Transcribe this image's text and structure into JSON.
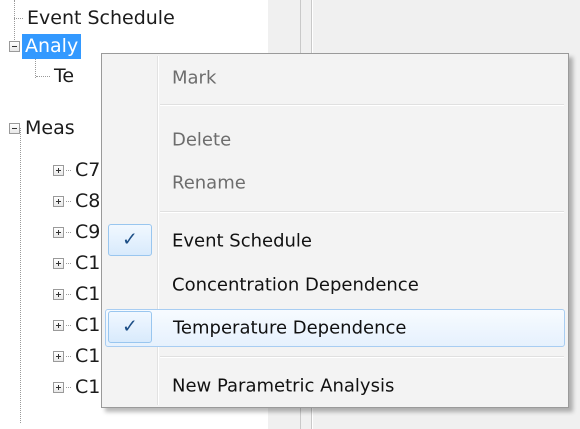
{
  "tree": {
    "nodes": [
      {
        "label": "Event Schedule",
        "expander": "none"
      },
      {
        "label": "Analy",
        "expander": "minus",
        "selected": true
      },
      {
        "label": "Te",
        "expander": "none"
      },
      {
        "label": "Meas",
        "expander": "minus"
      },
      {
        "label": "C7",
        "expander": "plus"
      },
      {
        "label": "C8",
        "expander": "plus"
      },
      {
        "label": "C9",
        "expander": "plus"
      },
      {
        "label": "C1",
        "expander": "plus"
      },
      {
        "label": "C1",
        "expander": "plus"
      },
      {
        "label": "C1",
        "expander": "plus"
      },
      {
        "label": "C1",
        "expander": "plus"
      },
      {
        "label": "C1",
        "expander": "plus"
      }
    ]
  },
  "context_menu": {
    "items": [
      {
        "label": "Mark",
        "enabled": false,
        "checked": false
      },
      {
        "label": "Delete",
        "enabled": false,
        "checked": false
      },
      {
        "label": "Rename",
        "enabled": false,
        "checked": false
      },
      {
        "label": "Event Schedule",
        "enabled": true,
        "checked": true
      },
      {
        "label": "Concentration Dependence",
        "enabled": true,
        "checked": false
      },
      {
        "label": "Temperature Dependence",
        "enabled": true,
        "checked": true,
        "highlighted": true
      },
      {
        "label": "New Parametric Analysis",
        "enabled": true,
        "checked": false
      }
    ],
    "check_glyph": "✓"
  },
  "colors": {
    "selection": "#3399ff",
    "menu_background": "#f3f3f3",
    "highlight_border": "#a8cdf2",
    "check_color": "#1d4f87"
  }
}
